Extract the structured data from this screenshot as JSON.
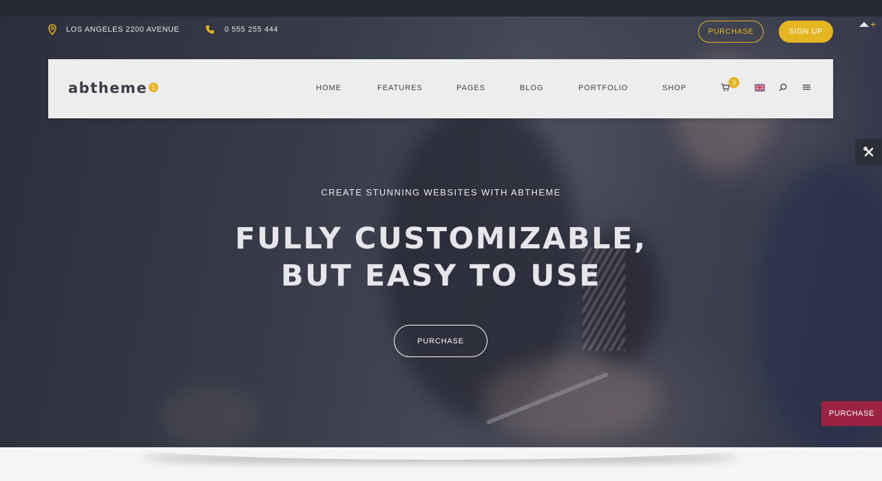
{
  "topbar": {
    "address": "LOS ANGELES 2200 AVENUE",
    "phone": "0 555 255 444",
    "purchase_label": "PURCHASE",
    "signup_label": "SIGN UP",
    "address_icon": "map-pin-icon",
    "phone_icon": "phone-icon"
  },
  "nav": {
    "logo": "abtheme",
    "logo_badge": "1",
    "menu": [
      {
        "label": "HOME"
      },
      {
        "label": "FEATURES"
      },
      {
        "label": "PAGES"
      },
      {
        "label": "BLOG"
      },
      {
        "label": "PORTFOLIO"
      },
      {
        "label": "SHOP"
      }
    ],
    "cart_count": "3",
    "icons": [
      "cart-icon",
      "uk-flag-icon",
      "search-icon",
      "hamburger-menu-icon"
    ]
  },
  "hero": {
    "subtitle": "CREATE STUNNING WEBSITES WITH ABTHEME",
    "headline_line1": "FULLY CUSTOMIZABLE,",
    "headline_line2": "BUT EASY TO USE",
    "button_label": "PURCHASE"
  },
  "side": {
    "purchase_label": "PURCHASE",
    "tools_icon": "tools-icon"
  },
  "colors": {
    "accent": "#e6b522",
    "side_purchase": "#9b2243",
    "nav_bg": "#ededee"
  }
}
